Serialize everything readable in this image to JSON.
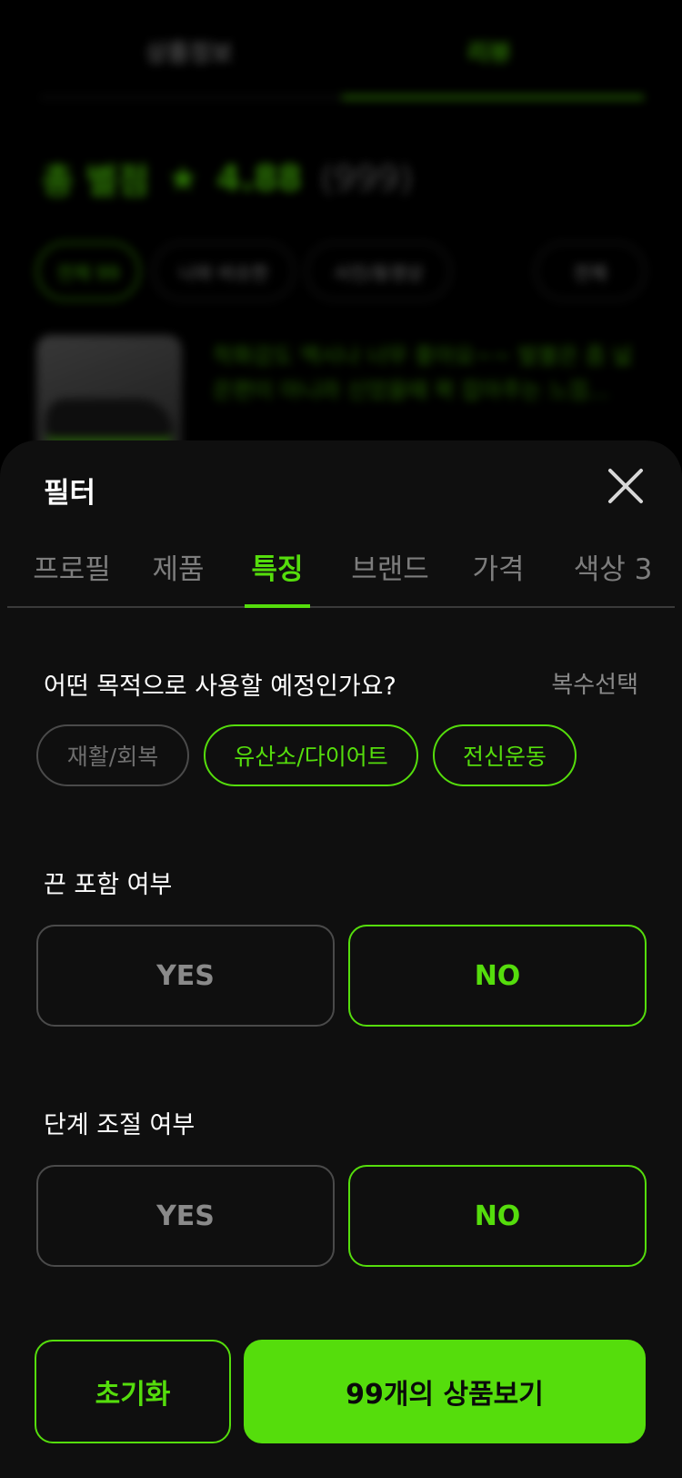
{
  "background": {
    "tabs": [
      "상품정보",
      "리뷰"
    ],
    "rating_label": "총 별점",
    "star": "★",
    "score": "4.88",
    "count": "(999)",
    "chips": [
      "전체 99",
      "나와 비슷한",
      "사진/동영상",
      "전체"
    ],
    "review_text": "착화감도 엑시나 너무 좋아요~~ 발볼은 좀 넓은편이 아니라 신었을때 꽉 잡아주는 느낌..."
  },
  "sheet": {
    "title": "필터",
    "tabs": [
      {
        "label": "프로필"
      },
      {
        "label": "제품"
      },
      {
        "label": "특징"
      },
      {
        "label": "브랜드"
      },
      {
        "label": "가격"
      },
      {
        "label": "색상 3"
      }
    ],
    "active_tab": "특징",
    "purpose": {
      "question": "어떤 목적으로 사용할 예정인가요?",
      "hint": "복수선택",
      "options": [
        {
          "label": "재활/회복",
          "selected": false
        },
        {
          "label": "유산소/다이어트",
          "selected": true
        },
        {
          "label": "전신운동",
          "selected": true
        }
      ]
    },
    "strap": {
      "question": "끈 포함 여부",
      "yes": "YES",
      "no": "NO",
      "selected": "NO"
    },
    "level": {
      "question": "단계 조절 여부",
      "yes": "YES",
      "no": "NO",
      "selected": "NO"
    },
    "reset_label": "초기화",
    "view_label": "99개의 상품보기"
  },
  "colors": {
    "accent": "#55dd0c",
    "sheet_bg": "#0f0f0f",
    "inactive_border": "#4a4a4a"
  },
  "icons": {
    "close": "close-icon"
  }
}
